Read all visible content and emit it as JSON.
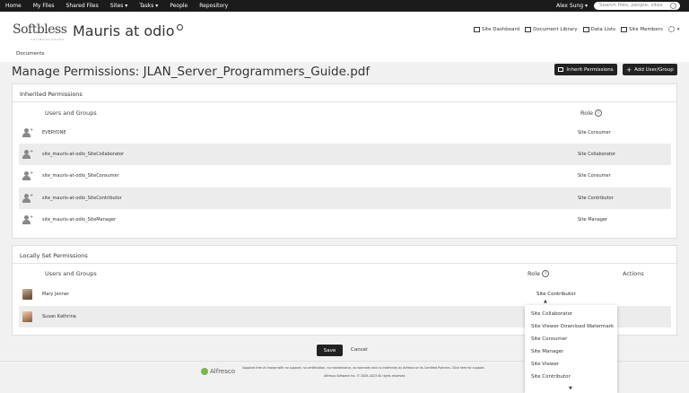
{
  "topbar": {
    "nav": [
      "Home",
      "My Files",
      "Shared Files",
      "Sites ▾",
      "Tasks ▾",
      "People",
      "Repository"
    ],
    "user": "Alex Sung ▾",
    "search_placeholder": "Search files, people, sites"
  },
  "header": {
    "logo": "Softbless",
    "logo_sub": "TECHNOLOGIES",
    "site_title": "Mauris at odio",
    "links": [
      "Site Dashboard",
      "Document Library",
      "Data Lists",
      "Site Members"
    ],
    "breadcrumb": "Documents"
  },
  "page": {
    "title": "Manage Permissions: JLAN_Server_Programmers_Guide.pdf",
    "inherit_button": "Inherit Permissions",
    "add_button": "Add User/Group"
  },
  "inherited": {
    "title": "Inherited Permissions",
    "col_users": "Users and Groups",
    "col_role": "Role",
    "rows": [
      {
        "name": "EVERYONE",
        "role": "Site Consumer"
      },
      {
        "name": "site_mauris-at-odio_SiteCollaborator",
        "role": "Site Collaborator"
      },
      {
        "name": "site_mauris-at-odio_SiteConsumer",
        "role": "Site Consumer"
      },
      {
        "name": "site_mauris-at-odio_SiteContributor",
        "role": "Site Contributor"
      },
      {
        "name": "site_mauris-at-odio_SiteManager",
        "role": "Site Manager"
      }
    ]
  },
  "local": {
    "title": "Locally Set Permissions",
    "col_users": "Users and Groups",
    "col_role": "Role",
    "col_actions": "Actions",
    "rows": [
      {
        "name": "Mary Jenner",
        "role": "Site Contributor"
      },
      {
        "name": "Susan Kathrina",
        "role": ""
      }
    ]
  },
  "role_dropdown": {
    "options": [
      "Site Collaborator",
      "Site Viewer Download Watermark",
      "Site Consumer",
      "Site Manager",
      "Site Viewer",
      "Site Contributor"
    ]
  },
  "actions": {
    "save": "Save",
    "cancel": "Cancel"
  },
  "footer": {
    "brand": "Alfresco",
    "line1": "Supplied free of charge with no support, no certification, no maintenance, no warranty and no indemnity by Alfresco or its Certified Partners. Click here for support.",
    "line2": "Alfresco Software Inc. © 2005-2023 All rights reserved."
  }
}
